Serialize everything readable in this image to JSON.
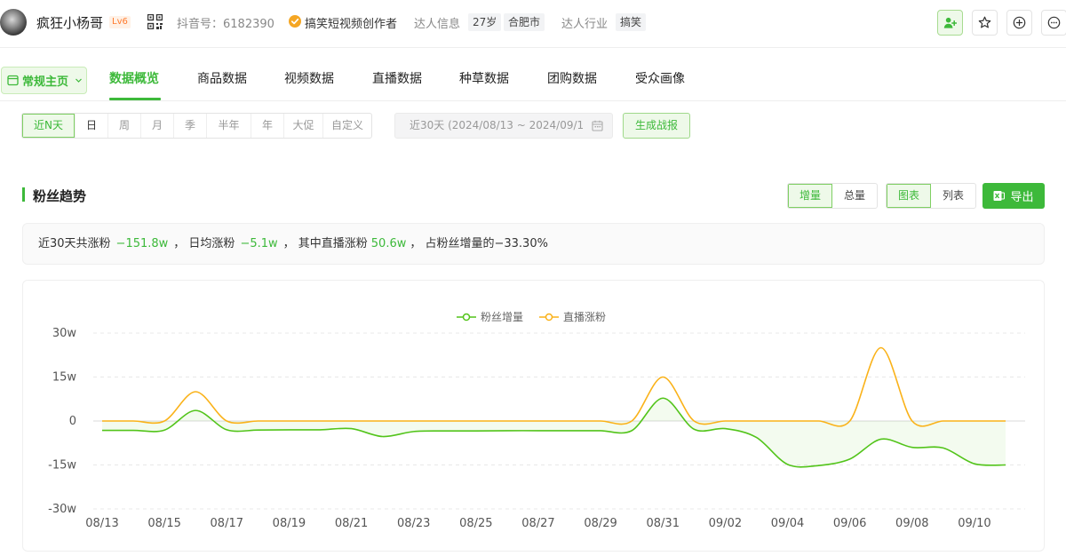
{
  "header": {
    "name": "疯狂小杨哥",
    "level": "Lv6",
    "douyin_id": "抖音号：6182390",
    "verify_text": "搞笑短视频创作者",
    "info_label": "达人信息",
    "age_tag": "27岁",
    "city_tag": "合肥市",
    "industry_label": "达人行业",
    "industry_tag": "搞笑"
  },
  "nav": {
    "home_dropdown": "常规主页",
    "tabs": [
      "数据概览",
      "商品数据",
      "视频数据",
      "直播数据",
      "种草数据",
      "团购数据",
      "受众画像"
    ],
    "active_tab": "数据概览"
  },
  "filters": {
    "ranges": [
      "近N天",
      "日",
      "周",
      "月",
      "季",
      "半年",
      "年",
      "大促",
      "自定义"
    ],
    "selected": "近N天",
    "date_range": "近30天 (2024/08/13 ~ 2024/09/1",
    "generate_button": "生成战报"
  },
  "section": {
    "title": "粉丝趋势",
    "mode_toggle": [
      "增量",
      "总量"
    ],
    "mode_selected": "增量",
    "view_toggle": [
      "图表",
      "列表"
    ],
    "view_selected": "图表",
    "export_label": "导出"
  },
  "summary": {
    "t1": "近30天共涨粉",
    "total": "−151.8w",
    "t2": "，  日均涨粉",
    "daily": "−5.1w",
    "t3": "，  其中直播涨粉",
    "live": "50.6w",
    "t4": "，  占粉丝增量的−33.30%"
  },
  "colors": {
    "green": "#52c41a",
    "orange": "#fab219",
    "accent": "#3db93a"
  },
  "chart_data": {
    "type": "line",
    "x": [
      "08/13",
      "08/14",
      "08/15",
      "08/16",
      "08/17",
      "08/18",
      "08/19",
      "08/20",
      "08/21",
      "08/22",
      "08/23",
      "08/24",
      "08/25",
      "08/26",
      "08/27",
      "08/28",
      "08/29",
      "08/30",
      "08/31",
      "09/01",
      "09/02",
      "09/03",
      "09/04",
      "09/05",
      "09/06",
      "09/07",
      "09/08",
      "09/09",
      "09/10",
      "09/11"
    ],
    "tick_labels": [
      "08/13",
      "08/15",
      "08/17",
      "08/19",
      "08/21",
      "08/23",
      "08/25",
      "08/27",
      "08/29",
      "08/31",
      "09/02",
      "09/04",
      "09/06",
      "09/08",
      "09/10"
    ],
    "series": [
      {
        "name": "粉丝增量",
        "color": "#52c41a",
        "values": [
          -3.2,
          -3.2,
          -3.1,
          3.6,
          -3.0,
          -3.1,
          -3.0,
          -3.0,
          -2.6,
          -5.3,
          -3.6,
          -3.4,
          -3.4,
          -3.3,
          -3.3,
          -3.3,
          -3.3,
          -3.3,
          7.8,
          -2.8,
          -2.6,
          -5.6,
          -14.8,
          -15.2,
          -13.0,
          -6.2,
          -9.0,
          -9.2,
          -14.6,
          -15.0
        ]
      },
      {
        "name": "直播涨粉",
        "color": "#fab219",
        "values": [
          0,
          0,
          0,
          10.0,
          0,
          0,
          0,
          0,
          0,
          0,
          0,
          0,
          0,
          0,
          0,
          0,
          0,
          0,
          15.0,
          0,
          0,
          0,
          0,
          0,
          0,
          25.0,
          0,
          0,
          0,
          0
        ]
      }
    ],
    "yticks": [
      "30w",
      "15w",
      "0",
      "-15w",
      "-30w"
    ],
    "ylim": [
      -30,
      30
    ],
    "grid": true,
    "legend_position": "top-center"
  }
}
